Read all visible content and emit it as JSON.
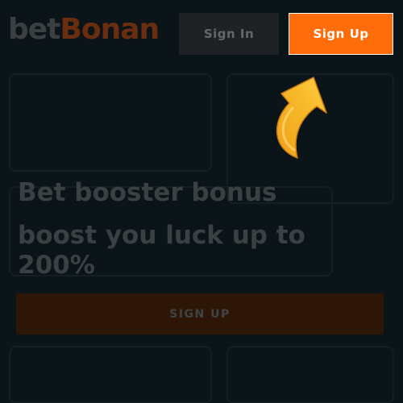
{
  "header": {
    "logo": {
      "part1": "bet",
      "part2": "Bonan"
    },
    "signin_label": "Sign In",
    "signup_label": "Sign Up"
  },
  "promo": {
    "headline": "Bet booster bonus",
    "subline": "boost you luck up to 200%",
    "cta_label": "SIGN UP"
  },
  "colors": {
    "background": "#0b1519",
    "accent": "#ff6c0a",
    "cta_dimmed": "#2e1606",
    "text_dimmed": "#3b4043"
  },
  "decoration": {
    "arrow_icon": "orange-arrow-up-right-icon"
  }
}
